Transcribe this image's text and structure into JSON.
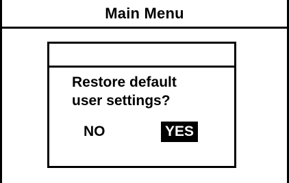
{
  "header": {
    "title": "Main Menu"
  },
  "dialog": {
    "title": "",
    "message_line1": "Restore default",
    "message_line2": "user settings?",
    "no_label": "NO",
    "yes_label": "YES",
    "selected": "YES"
  }
}
